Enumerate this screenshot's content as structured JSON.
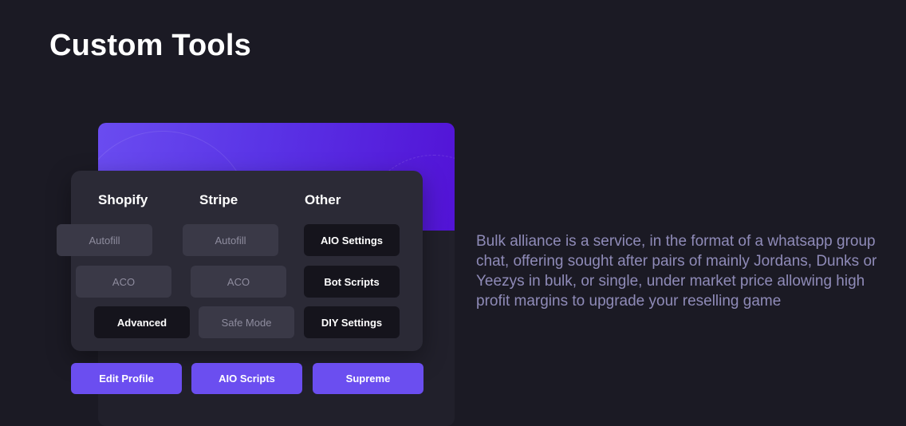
{
  "heading": "Custom Tools",
  "columns": [
    {
      "title": "Shopify",
      "chips": [
        "Autofill",
        "ACO",
        "Advanced"
      ]
    },
    {
      "title": "Stripe",
      "chips": [
        "Autofill",
        "ACO",
        "Safe Mode"
      ]
    },
    {
      "title": "Other",
      "chips": [
        "AIO Settings",
        "Bot Scripts",
        "DIY Settings"
      ]
    }
  ],
  "buttons": [
    "Edit Profile",
    "AIO Scripts",
    "Supreme"
  ],
  "description": "Bulk alliance is a service, in the format of a whatsapp group chat, offering sought after pairs of mainly Jordans, Dunks or Yeezys in bulk, or single, under market price allowing high profit margins to upgrade your reselling game",
  "colors": {
    "background": "#1b1a24",
    "accent": "#6b4ef0",
    "banner_gradient_start": "#6a4cf0",
    "banner_gradient_end": "#5213d6",
    "panel": "#2b2a36",
    "description_text": "#8f8bb8"
  }
}
